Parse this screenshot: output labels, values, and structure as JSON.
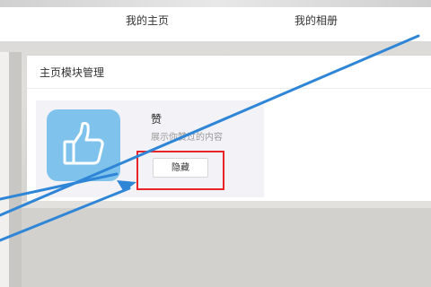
{
  "nav": {
    "home": "我的主页",
    "album": "我的相册"
  },
  "panel": {
    "title": "主页模块管理"
  },
  "module": {
    "icon": "thumbs-up-icon",
    "name": "赞",
    "description": "展示你赞过的内容",
    "hide_label": "隐藏"
  },
  "colors": {
    "icon_bg": "#7fc3ec",
    "highlight": "#e8242b",
    "arrow": "#2f86d6"
  }
}
